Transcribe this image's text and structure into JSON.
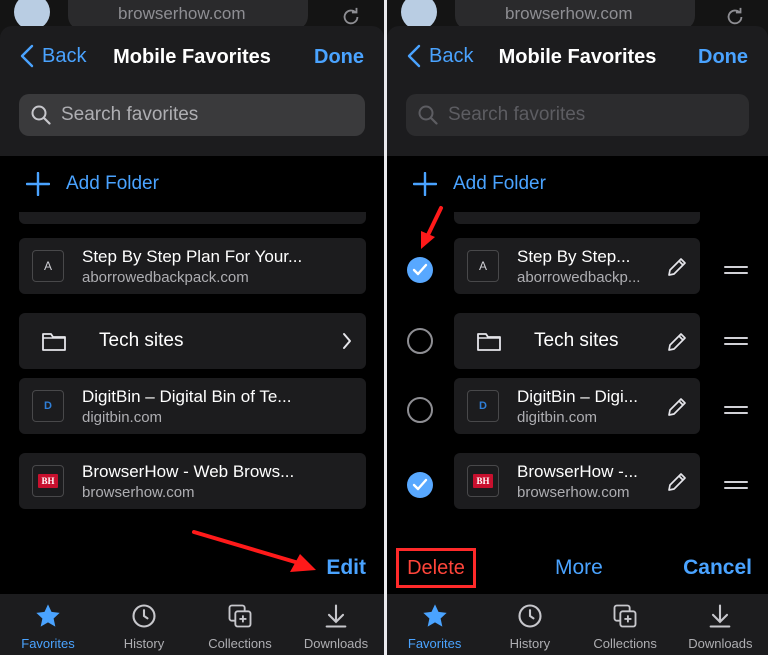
{
  "colors": {
    "accent": "#4aa3ff",
    "destructive": "#ff453a",
    "sheet": "#1c1c1e",
    "annotation": "#ff1a1a"
  },
  "browser": {
    "url": "browserhow.com"
  },
  "header": {
    "back_label": "Back",
    "title": "Mobile Favorites",
    "done_label": "Done"
  },
  "search": {
    "placeholder": "Search favorites"
  },
  "add_folder": {
    "label": "Add Folder"
  },
  "left": {
    "items": [
      {
        "type": "bookmark",
        "favicon_text": "A",
        "title": "Step By Step Plan For Your...",
        "subtitle": "aborrowedbackpack.com"
      },
      {
        "type": "folder",
        "title": "Tech sites"
      },
      {
        "type": "bookmark",
        "favicon_text": "D",
        "title": "DigitBin – Digital Bin of Te...",
        "subtitle": "digitbin.com"
      },
      {
        "type": "bookmark",
        "favicon_text": "BH",
        "title": "BrowserHow - Web Brows...",
        "subtitle": "browserhow.com"
      }
    ],
    "edit_label": "Edit"
  },
  "right": {
    "items": [
      {
        "type": "bookmark",
        "favicon_text": "A",
        "title": "Step By Step...",
        "subtitle": "aborrowedbackp...",
        "selected": true
      },
      {
        "type": "folder",
        "title": "Tech sites",
        "selected": false
      },
      {
        "type": "bookmark",
        "favicon_text": "D",
        "title": "DigitBin – Digi...",
        "subtitle": "digitbin.com",
        "selected": false
      },
      {
        "type": "bookmark",
        "favicon_text": "BH",
        "title": "BrowserHow -...",
        "subtitle": "browserhow.com",
        "selected": true
      }
    ],
    "delete_label": "Delete",
    "more_label": "More",
    "cancel_label": "Cancel"
  },
  "tabs": [
    {
      "label": "Favorites",
      "icon": "star-icon",
      "active": true
    },
    {
      "label": "History",
      "icon": "history-icon",
      "active": false
    },
    {
      "label": "Collections",
      "icon": "collections-icon",
      "active": false
    },
    {
      "label": "Downloads",
      "icon": "download-icon",
      "active": false
    }
  ]
}
